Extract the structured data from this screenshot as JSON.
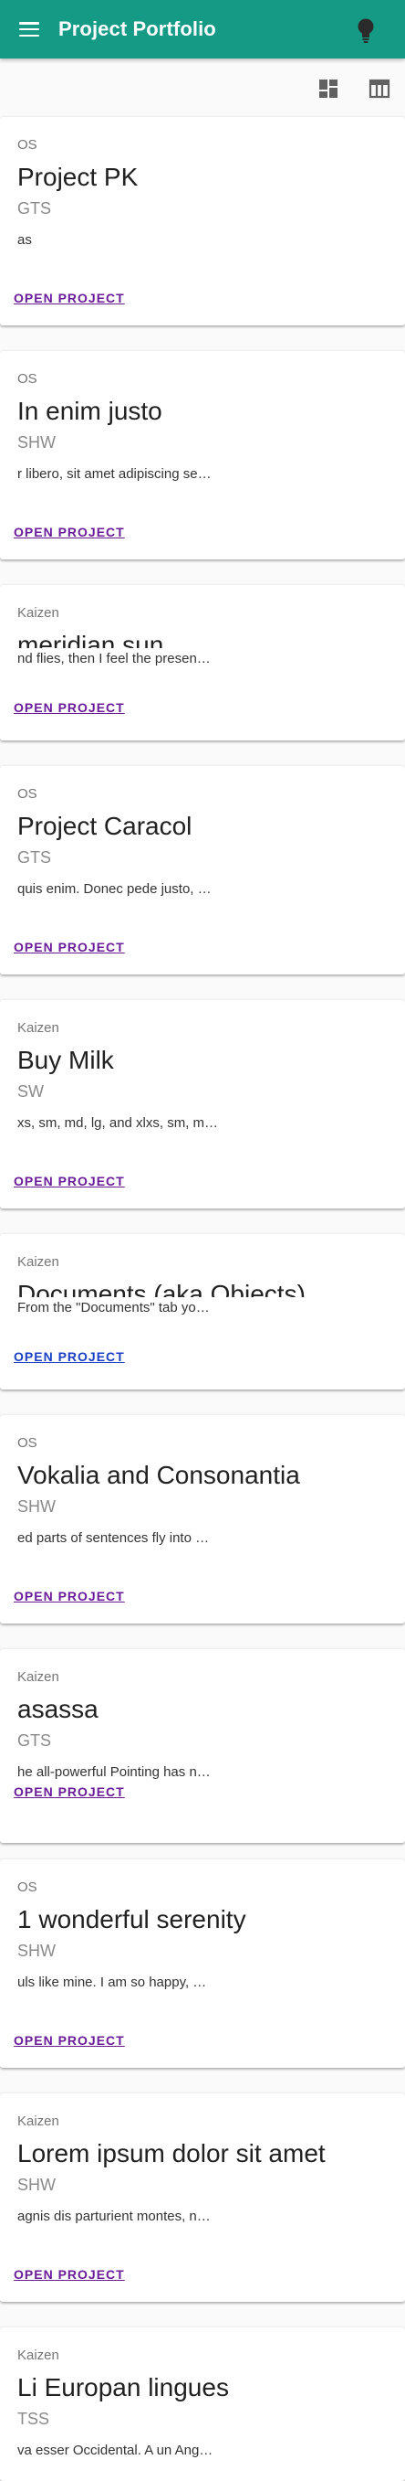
{
  "app": {
    "title": "Project Portfolio"
  },
  "icons": {
    "menu": "menu-icon",
    "bulb": "lightbulb-icon",
    "dashboard": "dashboard-view-icon",
    "table": "table-view-icon"
  },
  "colors": {
    "appbar": "#159a85",
    "link_visited": "#6a1b9a",
    "link": "#1a3fc4"
  },
  "projects": [
    {
      "category": "OS",
      "name": "Project PK",
      "code": "GTS",
      "description": "as",
      "action": "OPEN PROJECT"
    },
    {
      "category": "OS",
      "name": "In enim justo",
      "code": "SHW",
      "description": "r libero, sit amet adipiscing se…",
      "action": "OPEN PROJECT"
    },
    {
      "category": "Kaizen",
      "name": "meridian sun",
      "code": "",
      "description": "nd flies, then I feel the presen…",
      "action": "OPEN PROJECT"
    },
    {
      "category": "OS",
      "name": "Project Caracol",
      "code": "GTS",
      "description": "quis enim. Donec pede justo, …",
      "action": "OPEN PROJECT"
    },
    {
      "category": "Kaizen",
      "name": "Buy Milk",
      "code": "SW",
      "description": "xs, sm, md, lg, and xlxs, sm, m…",
      "action": "OPEN PROJECT"
    },
    {
      "category": "Kaizen",
      "name": "Documents (aka Objects)",
      "code": "",
      "description": "From the \"Documents\" tab yo…",
      "action": "OPEN PROJECT"
    },
    {
      "category": "OS",
      "name": "Vokalia and Consonantia",
      "code": "SHW",
      "description": "ed parts of sentences fly into …",
      "action": "OPEN PROJECT"
    },
    {
      "category": "Kaizen",
      "name": "asassa",
      "code": "GTS",
      "description": "he all-powerful Pointing has n…",
      "action": "OPEN PROJECT"
    },
    {
      "category": "OS",
      "name": "1 wonderful serenity",
      "code": "SHW",
      "description": "uls like mine. I am so happy, …",
      "action": "OPEN PROJECT"
    },
    {
      "category": "Kaizen",
      "name": "Lorem ipsum dolor sit amet",
      "code": "SHW",
      "description": "agnis dis parturient montes, n…",
      "action": "OPEN PROJECT"
    },
    {
      "category": "Kaizen",
      "name": "Li Europan lingues",
      "code": "TSS",
      "description": "va esser Occidental. A un Ang…",
      "action": ""
    }
  ]
}
